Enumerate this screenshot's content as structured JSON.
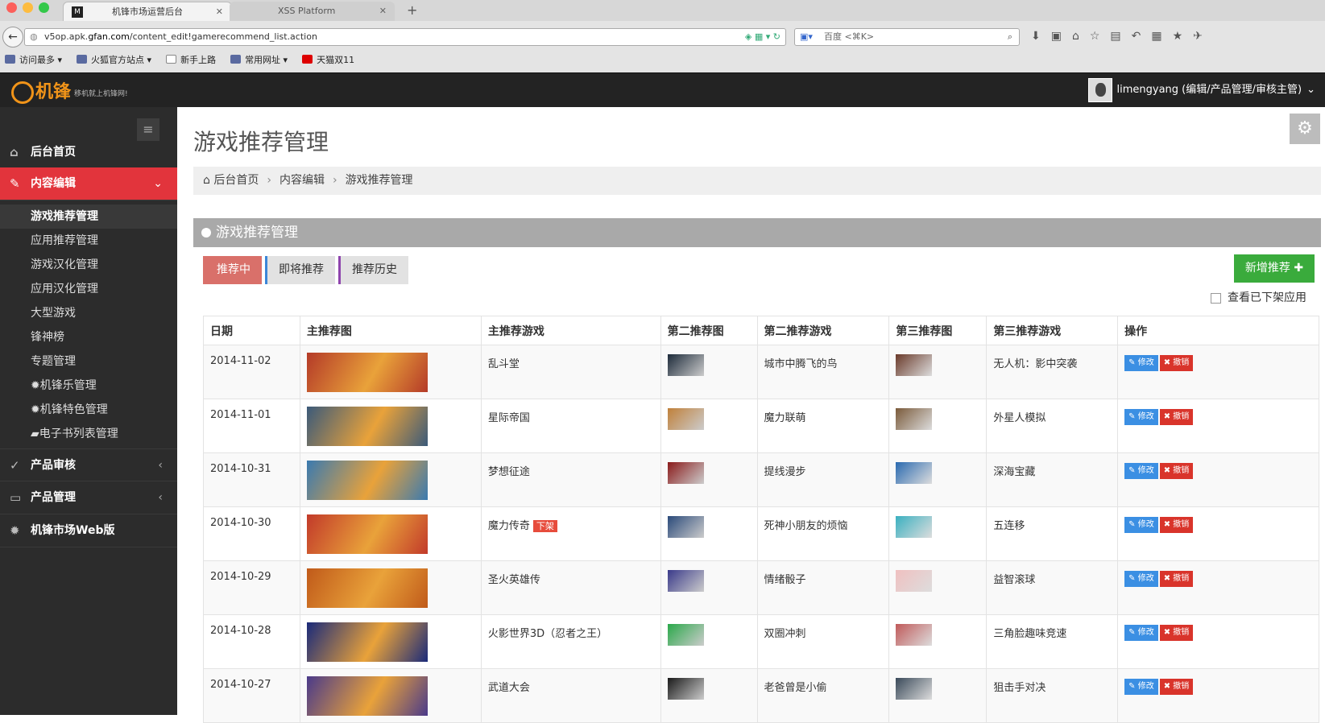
{
  "browser": {
    "tabs": [
      {
        "title": "机锋市场运营后台",
        "favicon": "M"
      },
      {
        "title": "XSS Platform"
      }
    ],
    "url_prefix": "v5op.apk.",
    "url_domain": "gfan.com",
    "url_path": "/content_edit!gamerecommend_list.action",
    "search_placeholder": "百度 <⌘K>",
    "bookmarks": [
      "访问最多 ▾",
      "火狐官方站点 ▾",
      "新手上路",
      "常用网址 ▾",
      "天猫双11"
    ]
  },
  "header": {
    "logo_text": "机锋",
    "logo_tagline": "移机就上机锋网!",
    "user_label": "limengyang (编辑/产品管理/审核主管)"
  },
  "sidebar": {
    "top_items": [
      {
        "label": "后台首页",
        "icon": "home-icon"
      },
      {
        "label": "内容编辑",
        "icon": "edit-icon"
      }
    ],
    "sub_items": [
      "游戏推荐管理",
      "应用推荐管理",
      "游戏汉化管理",
      "应用汉化管理",
      "大型游戏",
      "锋神榜",
      "专题管理",
      "机锋乐管理",
      "机锋特色管理",
      "电子书列表管理"
    ],
    "bottom_items": [
      {
        "label": "产品审核",
        "icon": "check-circle-icon"
      },
      {
        "label": "产品管理",
        "icon": "hdd-icon"
      },
      {
        "label": "机锋市场Web版",
        "icon": "android-icon"
      }
    ]
  },
  "main": {
    "page_title": "游戏推荐管理",
    "breadcrumb": [
      "后台首页",
      "内容编辑",
      "游戏推荐管理"
    ],
    "panel_title": "游戏推荐管理",
    "tabs": [
      "推荐中",
      "即将推荐",
      "推荐历史"
    ],
    "add_button": "新增推荐",
    "show_offline_label": "查看已下架应用",
    "columns": [
      "日期",
      "主推荐图",
      "主推荐游戏",
      "第二推荐图",
      "第二推荐游戏",
      "第三推荐图",
      "第三推荐游戏",
      "操作"
    ],
    "edit_label": "修改",
    "revoke_label": "撤销",
    "offline_badge": "下架",
    "rows": [
      {
        "date": "2014-11-02",
        "main_game": "乱斗堂",
        "second_game": "城市中腾飞的鸟",
        "third_game": "无人机：影中突袭",
        "offline": false,
        "c1": "#b43a28",
        "c2": "#1c2a3a",
        "c3": "#6a3a2a"
      },
      {
        "date": "2014-11-01",
        "main_game": "星际帝国",
        "second_game": "魔力联萌",
        "third_game": "外星人模拟",
        "offline": false,
        "c1": "#3b5a7a",
        "c2": "#c0803a",
        "c3": "#7a5a3a"
      },
      {
        "date": "2014-10-31",
        "main_game": "梦想征途",
        "second_game": "提线漫步",
        "third_game": "深海宝藏",
        "offline": false,
        "c1": "#3a7ab0",
        "c2": "#8a1a1a",
        "c3": "#2a6ab0"
      },
      {
        "date": "2014-10-30",
        "main_game": "魔力传奇",
        "second_game": "死神小朋友的烦恼",
        "third_game": "五连移",
        "offline": true,
        "c1": "#c23a2a",
        "c2": "#2a4a7a",
        "c3": "#3ab0c0"
      },
      {
        "date": "2014-10-29",
        "main_game": "圣火英雄传",
        "second_game": "情绪骰子",
        "third_game": "益智滚球",
        "offline": false,
        "c1": "#c05a1a",
        "c2": "#3a3a8a",
        "c3": "#f0c0c0"
      },
      {
        "date": "2014-10-28",
        "main_game": "火影世界3D（忍者之王）",
        "second_game": "双圈冲刺",
        "third_game": "三角脸趣味竞速",
        "offline": false,
        "c1": "#1a2a7a",
        "c2": "#2aa84a",
        "c3": "#c05a5a"
      },
      {
        "date": "2014-10-27",
        "main_game": "武道大会",
        "second_game": "老爸曾是小偷",
        "third_game": "狙击手对决",
        "offline": false,
        "c1": "#4a3a8a",
        "c2": "#1a1a1a",
        "c3": "#3a4a5a"
      }
    ]
  },
  "colors": {
    "accent_red": "#e2343c",
    "add_green": "#3aab3c",
    "edit_blue": "#3b8fe3",
    "revoke_red": "#d9342b"
  }
}
